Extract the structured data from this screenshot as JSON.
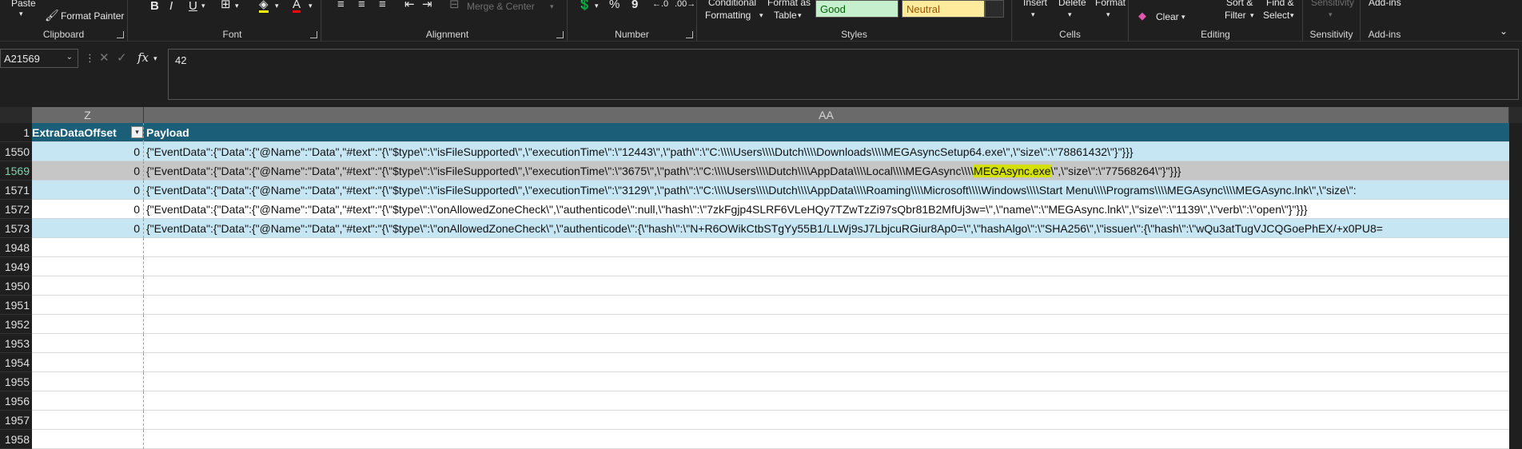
{
  "ribbon": {
    "clipboard": {
      "paste": "Paste",
      "format_painter": "Format Painter",
      "label": "Clipboard"
    },
    "font": {
      "label": "Font",
      "bold": "B",
      "italic": "I",
      "underline": "U"
    },
    "alignment": {
      "label": "Alignment",
      "merge": "Merge & Center"
    },
    "number": {
      "label": "Number",
      "percent": "%",
      "comma": "9"
    },
    "styles": {
      "label": "Styles",
      "conditional": "Conditional",
      "formatting": "Formatting",
      "format_as": "Format as",
      "table": "Table",
      "good": "Good",
      "neutral": "Neutral",
      "good_bg": "#c6efce",
      "good_fg": "#006100",
      "neutral_bg": "#ffeb9c",
      "neutral_fg": "#9c5700"
    },
    "cells": {
      "label": "Cells",
      "insert": "Insert",
      "delete": "Delete",
      "format": "Format"
    },
    "editing": {
      "label": "Editing",
      "clear": "Clear",
      "sort": "Sort &",
      "filter": "Filter",
      "find": "Find &",
      "select": "Select"
    },
    "sensitivity": {
      "label": "Sensitivity",
      "name": "Sensitivity"
    },
    "addins": {
      "label": "Add-ins",
      "name": "Add-ins"
    }
  },
  "formula_bar": {
    "name_box": "A21569",
    "value": "42"
  },
  "grid": {
    "col_z": "Z",
    "col_aa": "AA",
    "header": {
      "rownum": "1",
      "z": "ExtraDataOffset",
      "aa": "Payload"
    },
    "rows": [
      {
        "rownum": "1550",
        "z": "0",
        "aa": "{\"EventData\":{\"Data\":{\"@Name\":\"Data\",\"#text\":\"{\\\"$type\\\":\\\"isFileSupported\\\",\\\"executionTime\\\":\\\"12443\\\",\\\"path\\\":\\\"C:\\\\\\\\Users\\\\\\\\Dutch\\\\\\\\Downloads\\\\\\\\MEGAsyncSetup64.exe\\\",\\\"size\\\":\\\"78861432\\\"}\"}}}"
      },
      {
        "rownum": "1569",
        "z": "0",
        "aa_pre": "{\"EventData\":{\"Data\":{\"@Name\":\"Data\",\"#text\":\"{\\\"$type\\\":\\\"isFileSupported\\\",\\\"executionTime\\\":\\\"3675\\\",\\\"path\\\":\\\"C:\\\\\\\\Users\\\\\\\\Dutch\\\\\\\\AppData\\\\\\\\Local\\\\\\\\MEGAsync\\\\\\\\",
        "aa_hl": "MEGAsync.exe",
        "aa_post": "\\\",\\\"size\\\":\\\"77568264\\\"}\"}}}"
      },
      {
        "rownum": "1571",
        "z": "0",
        "aa": "{\"EventData\":{\"Data\":{\"@Name\":\"Data\",\"#text\":\"{\\\"$type\\\":\\\"isFileSupported\\\",\\\"executionTime\\\":\\\"3129\\\",\\\"path\\\":\\\"C:\\\\\\\\Users\\\\\\\\Dutch\\\\\\\\AppData\\\\\\\\Roaming\\\\\\\\Microsoft\\\\\\\\Windows\\\\\\\\Start Menu\\\\\\\\Programs\\\\\\\\MEGAsync\\\\\\\\MEGAsync.lnk\\\",\\\"size\\\":"
      },
      {
        "rownum": "1572",
        "z": "0",
        "aa": "{\"EventData\":{\"Data\":{\"@Name\":\"Data\",\"#text\":\"{\\\"$type\\\":\\\"onAllowedZoneCheck\\\",\\\"authenticode\\\":null,\\\"hash\\\":\\\"7zkFgjp4SLRF6VLeHQy7TZwTzZi97sQbr81B2MfUj3w=\\\",\\\"name\\\":\\\"MEGAsync.lnk\\\",\\\"size\\\":\\\"1139\\\",\\\"verb\\\":\\\"open\\\"}\"}}}"
      },
      {
        "rownum": "1573",
        "z": "0",
        "aa": "{\"EventData\":{\"Data\":{\"@Name\":\"Data\",\"#text\":\"{\\\"$type\\\":\\\"onAllowedZoneCheck\\\",\\\"authenticode\\\":{\\\"hash\\\":\\\"N+R6OWikCtbSTgYy55B1/LLWj9sJ7LbjcuRGiur8Ap0=\\\",\\\"hashAlgo\\\":\\\"SHA256\\\",\\\"issuer\\\":{\\\"hash\\\":\\\"wQu3atTugVJCQGoePhEX/+x0PU8="
      }
    ],
    "empty_rows": [
      "1948",
      "1949",
      "1950",
      "1951",
      "1952",
      "1953",
      "1954",
      "1955",
      "1956",
      "1957",
      "1958"
    ]
  }
}
